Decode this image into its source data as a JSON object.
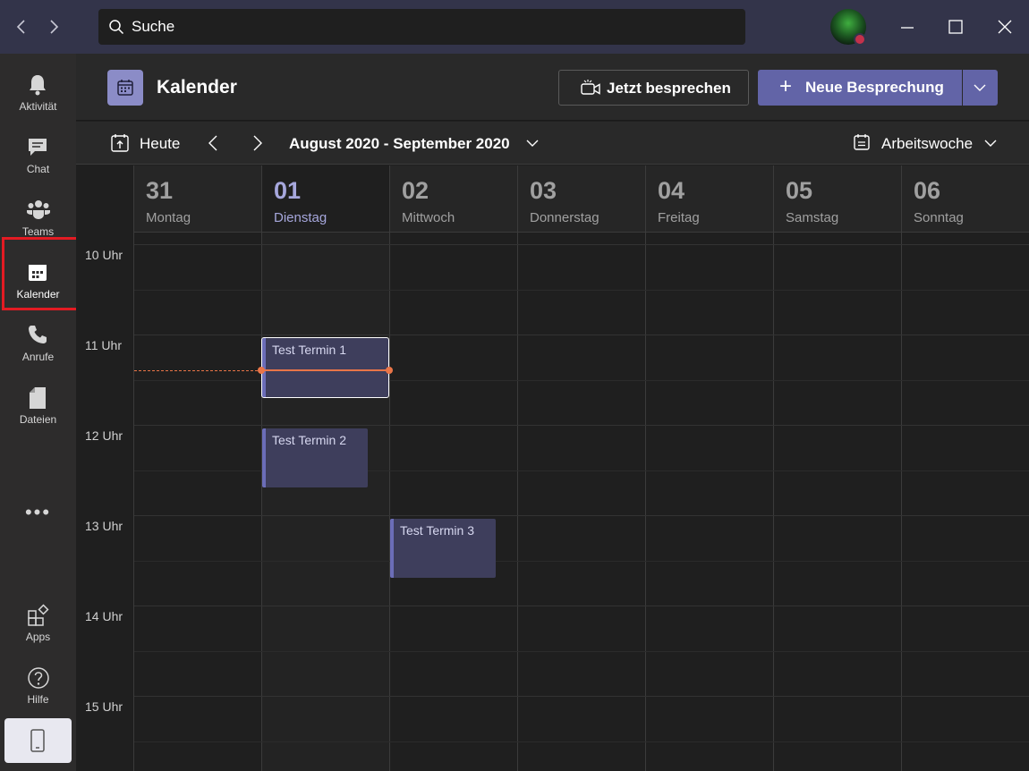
{
  "titlebar": {
    "back_icon": "chevron-left-icon",
    "forward_icon": "chevron-right-icon",
    "search_placeholder": "Suche"
  },
  "rail": {
    "items": [
      {
        "label": "Aktivität",
        "icon": "bell-icon"
      },
      {
        "label": "Chat",
        "icon": "chat-icon"
      },
      {
        "label": "Teams",
        "icon": "teams-icon"
      },
      {
        "label": "Kalender",
        "icon": "calendar-icon",
        "active": true
      },
      {
        "label": "Anrufe",
        "icon": "phone-icon"
      },
      {
        "label": "Dateien",
        "icon": "file-icon"
      }
    ],
    "more": "•••",
    "bottom_items": [
      {
        "label": "Apps",
        "icon": "apps-icon"
      },
      {
        "label": "Hilfe",
        "icon": "help-icon"
      }
    ]
  },
  "header": {
    "title": "Kalender",
    "meet_now": "Jetzt besprechen",
    "new_meeting": "Neue Besprechung"
  },
  "toolbar": {
    "today": "Heute",
    "date_range": "August 2020 - September 2020",
    "view": "Arbeitswoche"
  },
  "days": [
    {
      "num": "31",
      "name": "Montag"
    },
    {
      "num": "01",
      "name": "Dienstag",
      "today": true
    },
    {
      "num": "02",
      "name": "Mittwoch"
    },
    {
      "num": "03",
      "name": "Donnerstag"
    },
    {
      "num": "04",
      "name": "Freitag"
    },
    {
      "num": "05",
      "name": "Samstag"
    },
    {
      "num": "06",
      "name": "Sonntag"
    }
  ],
  "hours": [
    "10 Uhr",
    "11 Uhr",
    "12 Uhr",
    "13 Uhr",
    "14 Uhr",
    "15 Uhr"
  ],
  "events": [
    {
      "title": "Test Termin 1",
      "day": "01",
      "start": "11:00",
      "end": "11:30",
      "selected": true
    },
    {
      "title": "Test Termin 2",
      "day": "01",
      "start": "12:00",
      "end": "12:30"
    },
    {
      "title": "Test Termin 3",
      "day": "02",
      "start": "13:00",
      "end": "13:30"
    }
  ],
  "colors": {
    "accent": "#6264a7",
    "titlebar": "#33344a",
    "now_line": "#e97548",
    "highlight": "#e31b23"
  }
}
